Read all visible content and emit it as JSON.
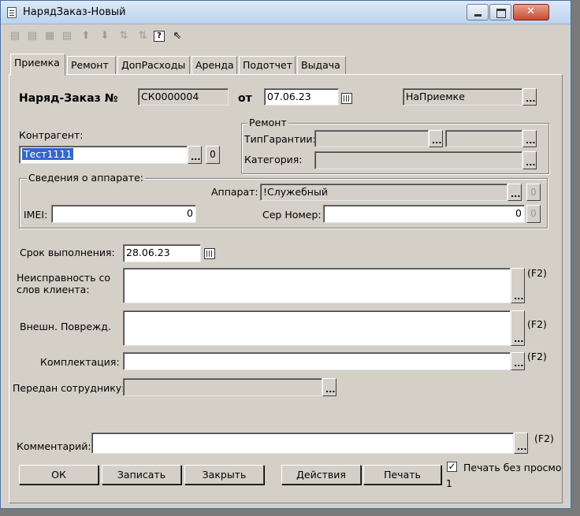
{
  "window": {
    "title": "НарядЗаказ-Новый"
  },
  "toolbar": {
    "icons": [
      "add-row-icon",
      "copy-row-icon",
      "edit-row-icon",
      "delete-row-icon",
      "move-up-icon",
      "move-down-icon",
      "sort-asc-icon",
      "sort-desc-icon",
      "help-icon",
      "pointer-help-icon"
    ]
  },
  "tabs": [
    "Приемка",
    "Ремонт",
    "ДопРасходы",
    "Аренда",
    "Подотчет",
    "Выдача"
  ],
  "header": {
    "order_label": "Наряд-Заказ №",
    "order_number": "СК0000004",
    "from_label": "от",
    "date": "07.06.23",
    "status": "НаПриемке"
  },
  "counterparty": {
    "label": "Контрагент:",
    "value": "Тест1111",
    "button": "0"
  },
  "repair": {
    "title": "Ремонт",
    "warranty_label": "ТипГарантии:",
    "category_label": "Категория:"
  },
  "device": {
    "title": "Сведения о аппарате:",
    "device_label": "Аппарат:",
    "device_value": "!Служебный",
    "imei_label": "IMEI:",
    "imei_value": "0",
    "serial_label": "Сер Номер:",
    "serial_value": "0",
    "btn_zero": "0"
  },
  "deadline": {
    "label": "Срок выполнения:",
    "value": "28.06.23"
  },
  "fault": {
    "label": "Неисправность со слов клиента:",
    "hint": "(F2)"
  },
  "damage": {
    "label": "Внешн. Поврежд.",
    "hint": "(F2)"
  },
  "kit": {
    "label": "Комплектация:",
    "hint": "(F2)"
  },
  "employee": {
    "label": "Передан сотруднику:"
  },
  "comment": {
    "label": "Комментарий:",
    "hint": "(F2)"
  },
  "buttons": {
    "ok": "ОК",
    "save": "Записать",
    "close": "Закрыть",
    "actions": "Действия",
    "print": "Печать"
  },
  "print_preview": {
    "label": "Печать без просмо",
    "checked": true,
    "count": "1"
  }
}
